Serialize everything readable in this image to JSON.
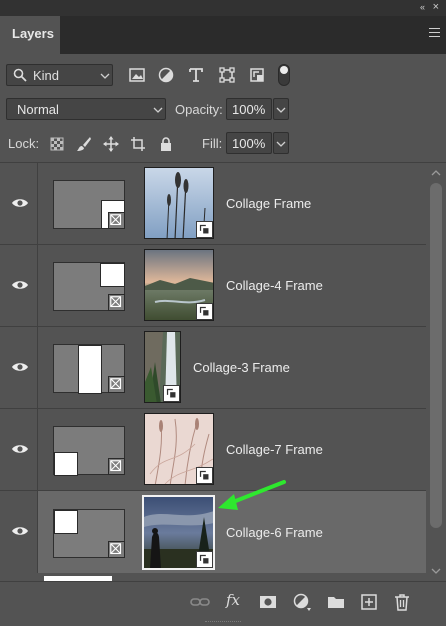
{
  "panel": {
    "tab_title": "Layers",
    "collapse_glyph": "«",
    "close_glyph": "×"
  },
  "filter": {
    "kind_label": "Kind",
    "icons": [
      "image-filter-icon",
      "adjustment-filter-icon",
      "type-filter-icon",
      "shape-filter-icon",
      "smart-object-filter-icon"
    ]
  },
  "blend": {
    "mode": "Normal",
    "opacity_label": "Opacity:",
    "opacity_value": "100%",
    "fill_label": "Fill:",
    "fill_value": "100%"
  },
  "lock": {
    "label": "Lock:",
    "icons": [
      "lock-transparent-pixels-icon",
      "lock-image-pixels-icon",
      "lock-position-icon",
      "artboard-autonest-icon",
      "lock-all-icon"
    ]
  },
  "layers": [
    {
      "name": "Collage Frame",
      "selected": false,
      "visible": true
    },
    {
      "name": "Collage-4 Frame",
      "selected": false,
      "visible": true
    },
    {
      "name": "Collage-3 Frame",
      "selected": false,
      "visible": true
    },
    {
      "name": "Collage-7 Frame",
      "selected": false,
      "visible": true
    },
    {
      "name": "Collage-6 Frame",
      "selected": true,
      "visible": true
    }
  ],
  "bottom_bar": {
    "fx_label": "fx",
    "icons": [
      "link-layers-icon",
      "layer-style-icon",
      "add-mask-icon",
      "adjustment-layer-icon",
      "new-group-icon",
      "new-layer-icon",
      "delete-layer-icon"
    ]
  },
  "colors": {
    "panel_bg": "#535353",
    "selected_row": "#696969",
    "annotation_arrow": "#2ee82e"
  }
}
